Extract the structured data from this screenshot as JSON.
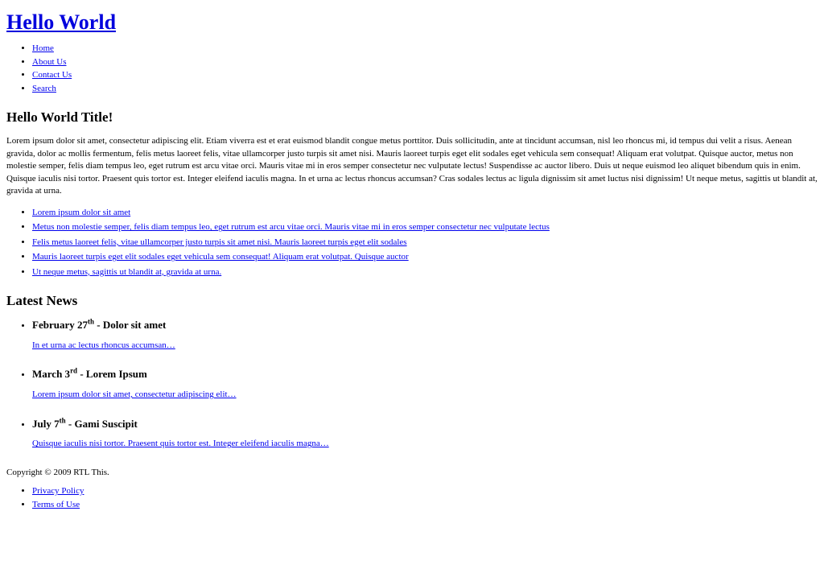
{
  "header": {
    "site_title": "Hello World",
    "nav": [
      {
        "label": "Home"
      },
      {
        "label": "About Us"
      },
      {
        "label": "Contact Us"
      },
      {
        "label": "Search"
      }
    ]
  },
  "main": {
    "page_title": "Hello World Title!",
    "intro_paragraph": "Lorem ipsum dolor sit amet, consectetur adipiscing elit. Etiam viverra est et erat euismod blandit congue metus porttitor. Duis sollicitudin, ante at tincidunt accumsan, nisl leo rhoncus mi, id tempus dui velit a risus. Aenean gravida, dolor ac mollis fermentum, felis metus laoreet felis, vitae ullamcorper justo turpis sit amet nisi. Mauris laoreet turpis eget elit sodales eget vehicula sem consequat! Aliquam erat volutpat. Quisque auctor, metus non molestie semper, felis diam tempus leo, eget rutrum est arcu vitae orci. Mauris vitae mi in eros semper consectetur nec vulputate lectus! Suspendisse ac auctor libero. Duis ut neque euismod leo aliquet bibendum quis in enim. Quisque iaculis nisi tortor. Praesent quis tortor est. Integer eleifend iaculis magna. In et urna ac lectus rhoncus accumsan? Cras sodales lectus ac ligula dignissim sit amet luctus nisi dignissim! Ut neque metus, sagittis ut blandit at, gravida at urna.",
    "link_list": [
      {
        "label": "Lorem ipsum dolor sit amet"
      },
      {
        "label": "Metus non molestie semper, felis diam tempus leo, eget rutrum est arcu vitae orci. Mauris vitae mi in eros semper consectetur nec vulputate lectus"
      },
      {
        "label": "Felis metus laoreet felis, vitae ullamcorper justo turpis sit amet nisi. Mauris laoreet turpis eget elit sodales"
      },
      {
        "label": "Mauris laoreet turpis eget elit sodales eget vehicula sem consequat! Aliquam erat volutpat. Quisque auctor"
      },
      {
        "label": "Ut neque metus, sagittis ut blandit at, gravida at urna."
      }
    ]
  },
  "news": {
    "section_title": "Latest News",
    "items": [
      {
        "month_day": "February 27",
        "ordinal": "th",
        "separator": " - ",
        "headline": "Dolor sit amet",
        "excerpt": "In et urna ac lectus rhoncus accumsan…"
      },
      {
        "month_day": "March 3",
        "ordinal": "rd",
        "separator": " - ",
        "headline": "Lorem Ipsum",
        "excerpt": "Lorem ipsum dolor sit amet, consectetur adipiscing elit…"
      },
      {
        "month_day": "July 7",
        "ordinal": "th",
        "separator": " - ",
        "headline": "Gami Suscipit",
        "excerpt": "Quisque iaculis nisi tortor. Praesent quis tortor est. Integer eleifend iaculis magna…"
      }
    ]
  },
  "footer": {
    "copyright": "Copyright © 2009 RTL This.",
    "links": [
      {
        "label": "Privacy Policy"
      },
      {
        "label": "Terms of Use"
      }
    ]
  },
  "colors": {
    "link": "#0000ee",
    "title_link": "#0000dd",
    "text": "#000000",
    "background": "#ffffff"
  }
}
